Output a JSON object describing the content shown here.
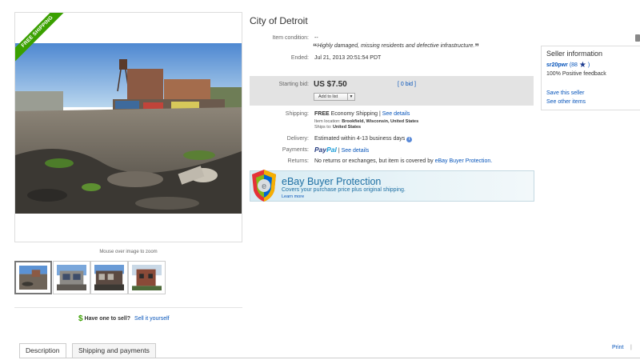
{
  "gallery": {
    "ribbon_text": "FREE SHIPPING",
    "zoom_hint": "Mouse over image to zoom",
    "thumbnails": [
      "thumbnail-1",
      "thumbnail-2",
      "thumbnail-3",
      "thumbnail-4"
    ],
    "selected_thumbnail": 0
  },
  "sell": {
    "icon": "$",
    "question": "Have one to sell?",
    "link": "Sell it yourself"
  },
  "item": {
    "title": "City of Detroit",
    "condition_label": "Item condition:",
    "condition_value": "--",
    "condition_quote": "Highly damaged, missing residents and defective infrastructure.",
    "ended_label": "Ended:",
    "ended_value": "Jul 21, 2013   20:51:54 PDT",
    "starting_bid_label": "Starting bid:",
    "starting_bid_value": "US $7.50",
    "bids_link": "[ 0 bid ]",
    "add_to_list": "Add to list",
    "shipping_label": "Shipping:",
    "shipping_free": "FREE",
    "shipping_method": "Economy Shipping",
    "shipping_sep": "|",
    "see_details": "See details",
    "item_location_label": "Item location:",
    "item_location_value": "Brookfield, Wisconsin, United States",
    "ships_to_label": "Ships to:",
    "ships_to_value": "United States",
    "delivery_label": "Delivery:",
    "delivery_value": "Estimated within 4-13 business days",
    "payments_label": "Payments:",
    "paypal_part1": "Pay",
    "paypal_part2": "Pal",
    "payments_sep": "|",
    "payments_details": "See details",
    "returns_label": "Returns:",
    "returns_value": "No returns or exchanges, but item is covered by",
    "returns_link": "eBay Buyer Protection."
  },
  "protection": {
    "title": "eBay Buyer Protection",
    "subtitle": "Covers your purchase price plus original shipping.",
    "learn_more": "Learn more"
  },
  "seller": {
    "title": "Seller information",
    "name": "sr20pwr",
    "feedback_open": "(",
    "feedback_score": "88",
    "feedback_close": ")",
    "positive": "100% Positive feedback",
    "save_link": "Save this seller",
    "other_items_link": "See other items"
  },
  "tabs": [
    "Description",
    "Shipping and payments"
  ],
  "footer": {
    "print": "Print",
    "separator": "|"
  },
  "colors": {
    "link": "#0654ba",
    "ribbon": "#3aa000",
    "bid_box": "#e3e3e3",
    "protection_text": "#1d6fa3",
    "star": "#1b3b8f"
  },
  "icons": [
    "free-shipping-ribbon",
    "dollar-icon",
    "info-icon",
    "dropdown-arrow-icon",
    "shield-icon",
    "star-icon",
    "window-icon"
  ]
}
